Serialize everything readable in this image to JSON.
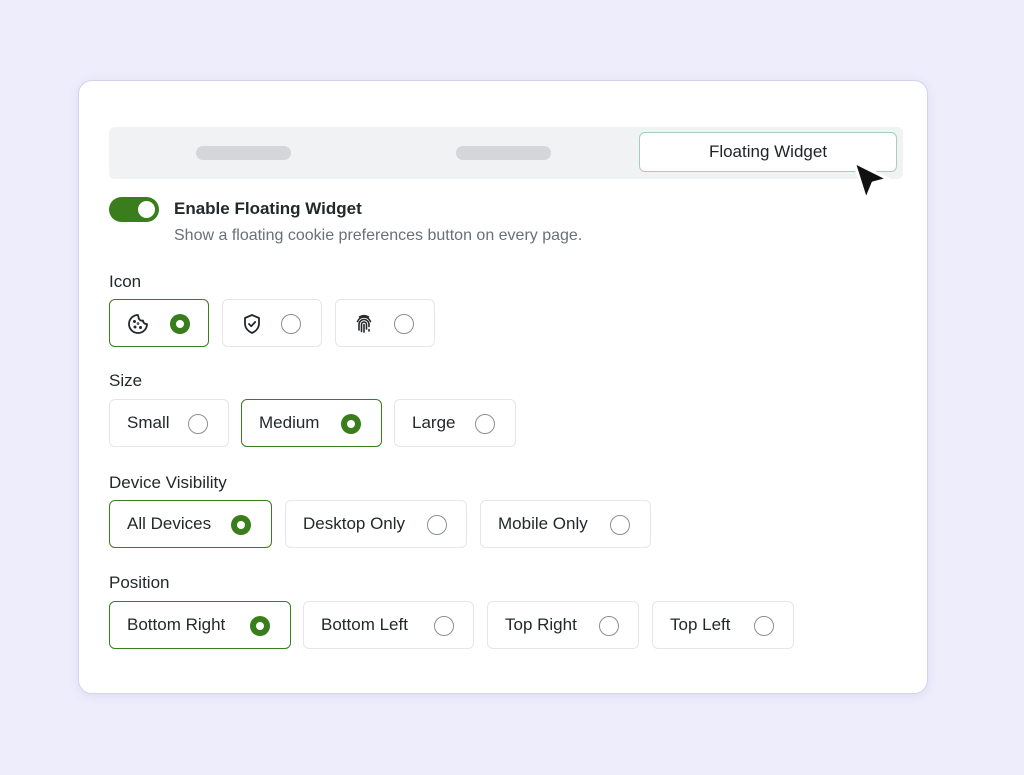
{
  "tabs": {
    "active_label": "Floating Widget"
  },
  "widget": {
    "enable_title": "Enable Floating Widget",
    "enable_description": "Show a floating cookie preferences button on every page.",
    "enabled": true
  },
  "icon_section": {
    "label": "Icon",
    "options": [
      {
        "icon": "cookie-icon",
        "selected": true
      },
      {
        "icon": "shield-check-icon",
        "selected": false
      },
      {
        "icon": "fingerprint-icon",
        "selected": false
      }
    ]
  },
  "size_section": {
    "label": "Size",
    "options": [
      {
        "label": "Small",
        "selected": false
      },
      {
        "label": "Medium",
        "selected": true
      },
      {
        "label": "Large",
        "selected": false
      }
    ]
  },
  "device_section": {
    "label": "Device Visibility",
    "options": [
      {
        "label": "All Devices",
        "selected": true
      },
      {
        "label": "Desktop Only",
        "selected": false
      },
      {
        "label": "Mobile Only",
        "selected": false
      }
    ]
  },
  "position_section": {
    "label": "Position",
    "options": [
      {
        "label": "Bottom Right",
        "selected": true
      },
      {
        "label": "Bottom Left",
        "selected": false
      },
      {
        "label": "Top Right",
        "selected": false
      },
      {
        "label": "Top Left",
        "selected": false
      }
    ]
  },
  "colors": {
    "accent": "#3a7d1c",
    "tab_active_border": "#a9cdbb",
    "background": "#eeedfb"
  }
}
